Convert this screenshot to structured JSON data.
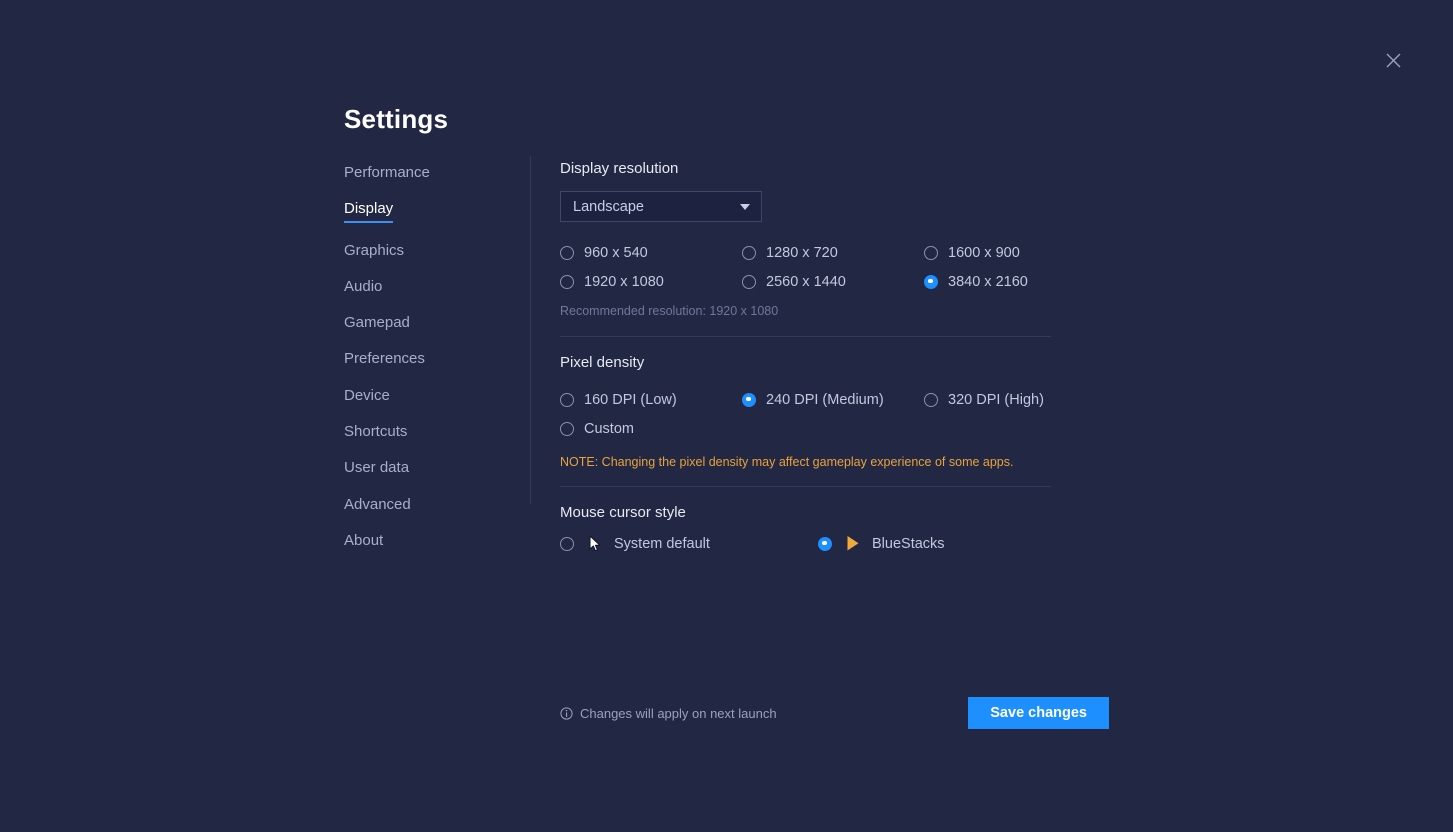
{
  "window": {
    "title": "Settings",
    "close_icon": "close-icon"
  },
  "sidebar": {
    "items": [
      {
        "label": "Performance",
        "active": false
      },
      {
        "label": "Display",
        "active": true
      },
      {
        "label": "Graphics",
        "active": false
      },
      {
        "label": "Audio",
        "active": false
      },
      {
        "label": "Gamepad",
        "active": false
      },
      {
        "label": "Preferences",
        "active": false
      },
      {
        "label": "Device",
        "active": false
      },
      {
        "label": "Shortcuts",
        "active": false
      },
      {
        "label": "User data",
        "active": false
      },
      {
        "label": "Advanced",
        "active": false
      },
      {
        "label": "About",
        "active": false
      }
    ]
  },
  "display_resolution": {
    "title": "Display resolution",
    "orientation_selected": "Landscape",
    "options": [
      {
        "label": "960 x 540",
        "selected": false
      },
      {
        "label": "1280 x 720",
        "selected": false
      },
      {
        "label": "1600 x 900",
        "selected": false
      },
      {
        "label": "1920 x 1080",
        "selected": false
      },
      {
        "label": "2560 x 1440",
        "selected": false
      },
      {
        "label": "3840 x 2160",
        "selected": true
      }
    ],
    "recommended": "Recommended resolution: 1920 x 1080"
  },
  "pixel_density": {
    "title": "Pixel density",
    "options": [
      {
        "label": "160 DPI (Low)",
        "selected": false
      },
      {
        "label": "240 DPI (Medium)",
        "selected": true
      },
      {
        "label": "320 DPI (High)",
        "selected": false
      },
      {
        "label": "Custom",
        "selected": false
      }
    ],
    "note": "NOTE: Changing the pixel density may affect gameplay experience of some apps."
  },
  "mouse_cursor_style": {
    "title": "Mouse cursor style",
    "options": [
      {
        "label": "System default",
        "selected": false,
        "icon": "system-cursor-icon"
      },
      {
        "label": "BlueStacks",
        "selected": true,
        "icon": "bluestacks-cursor-icon"
      }
    ]
  },
  "footer": {
    "info_icon": "info-icon",
    "note": "Changes will apply on next launch",
    "save_label": "Save changes"
  },
  "colors": {
    "background": "#222743",
    "accent_blue": "#1e8fff",
    "note_orange": "#e8a33d",
    "cursor_orange": "#f0a93c",
    "divider": "#343a5c"
  }
}
